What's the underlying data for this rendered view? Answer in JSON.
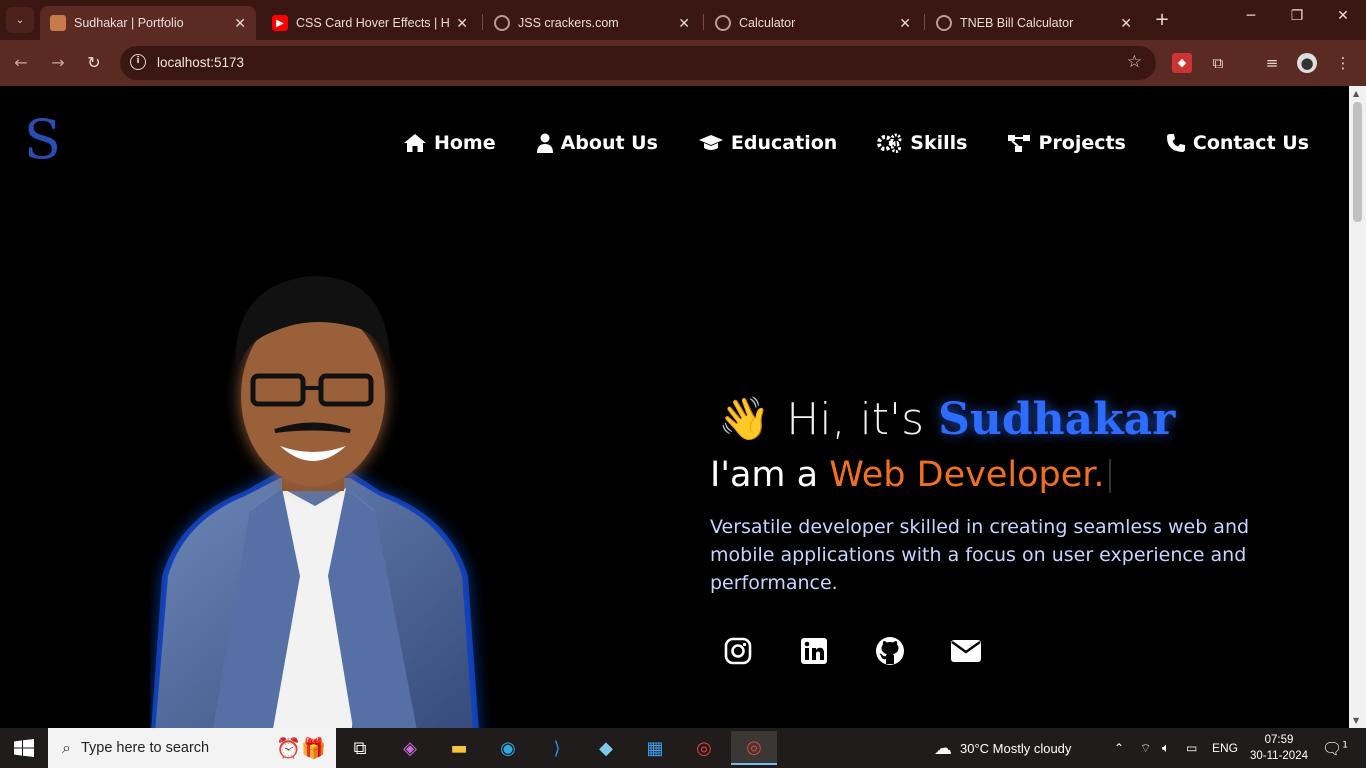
{
  "browser": {
    "tabs": [
      {
        "title": "Sudhakar | Portfolio",
        "active": true
      },
      {
        "title": "CSS Card Hover Effects | Htm"
      },
      {
        "title": "JSS crackers.com"
      },
      {
        "title": "Calculator"
      },
      {
        "title": "TNEB Bill Calculator"
      }
    ],
    "url": "localhost:5173"
  },
  "site": {
    "logo": "S",
    "nav": [
      "Home",
      "About Us",
      "Education",
      "Skills",
      "Projects",
      "Contact Us"
    ],
    "hero": {
      "wave": "👋",
      "greeting": "Hi, it's",
      "name": "Sudhakar",
      "role_prefix": "I'am a",
      "role": "Web Developer.",
      "description": "Versatile developer skilled in creating seamless web and mobile applications with a focus on user experience and performance."
    },
    "socials": [
      "instagram-icon",
      "linkedin-icon",
      "github-icon",
      "email-icon"
    ],
    "colors": {
      "accent_blue": "#2e6bff",
      "accent_orange": "#f07020",
      "logo": "#2a4db3"
    }
  },
  "taskbar": {
    "search_placeholder": "Type here to search",
    "weather": "30°C  Mostly cloudy",
    "language": "ENG",
    "time": "07:59",
    "date": "30-11-2024",
    "notification_count": "1"
  }
}
